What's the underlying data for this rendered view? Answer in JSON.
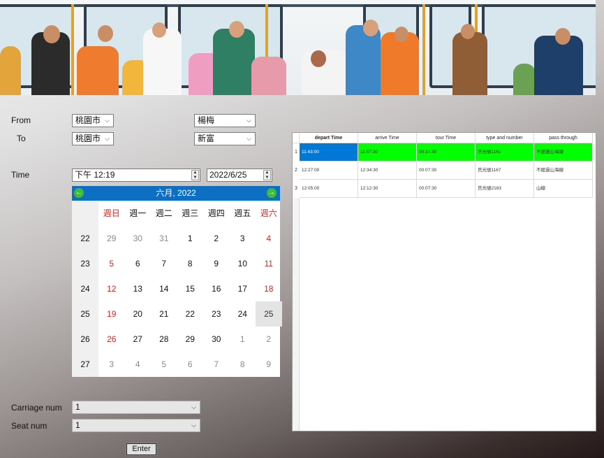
{
  "colors": {
    "calendar_header": "#0d6fc3",
    "nav_arrows": "#3fbd3a",
    "weekend_red": "#e0201a",
    "row_selected": "#0078d7",
    "row_highlight": "#00ff00"
  },
  "banner": {
    "icon": "train-passengers-illustration"
  },
  "form": {
    "from_label": "From",
    "to_label": "To",
    "time_label": "Time",
    "from_city": "桃園市",
    "from_station": "楊梅",
    "to_city": "桃園市",
    "to_station": "新富",
    "time_value": "下午 12:19",
    "date_value": "2022/6/25",
    "carriage_label": "Carriage num",
    "carriage_value": "1",
    "seat_label": "Seat num",
    "seat_value": "1",
    "enter_label": "Enter"
  },
  "calendar": {
    "title": "六月, 2022",
    "prev_icon": "arrow-left-icon",
    "next_icon": "arrow-right-icon",
    "weekdays": [
      "週日",
      "週一",
      "週二",
      "週三",
      "週四",
      "週五",
      "週六"
    ],
    "weeks": [
      {
        "num": "22",
        "days": [
          "29",
          "30",
          "31",
          "1",
          "2",
          "3",
          "4"
        ]
      },
      {
        "num": "23",
        "days": [
          "5",
          "6",
          "7",
          "8",
          "9",
          "10",
          "11"
        ]
      },
      {
        "num": "24",
        "days": [
          "12",
          "13",
          "14",
          "15",
          "16",
          "17",
          "18"
        ]
      },
      {
        "num": "25",
        "days": [
          "19",
          "20",
          "21",
          "22",
          "23",
          "24",
          "25"
        ]
      },
      {
        "num": "26",
        "days": [
          "26",
          "27",
          "28",
          "29",
          "30",
          "1",
          "2"
        ]
      },
      {
        "num": "27",
        "days": [
          "3",
          "4",
          "5",
          "6",
          "7",
          "8",
          "9"
        ]
      }
    ],
    "selected_day": "25"
  },
  "table": {
    "headers": [
      "depart Time",
      "arrive Time",
      "tour Time",
      "type and number",
      "pass through"
    ],
    "rows": [
      {
        "num": "1",
        "cells": [
          "11:43:00",
          "11:57:30",
          "00:14:30",
          "莒光號1161",
          "不經過山海線"
        ]
      },
      {
        "num": "2",
        "cells": [
          "12:27:00",
          "12:34:30",
          "00:07:30",
          "莒光號1167",
          "不經過山海線"
        ]
      },
      {
        "num": "3",
        "cells": [
          "12:05:00",
          "12:12:30",
          "00:07:30",
          "莒光號2183",
          "山線"
        ]
      }
    ]
  }
}
